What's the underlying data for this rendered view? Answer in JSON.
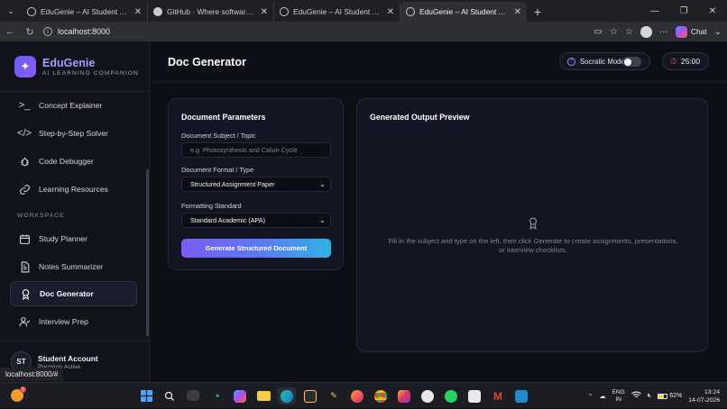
{
  "browser": {
    "tabs": [
      {
        "title": "EduGenie – AI Student Assistant",
        "active": false
      },
      {
        "title": "GitHub · Where software is built",
        "active": false
      },
      {
        "title": "EduGenie – AI Student Assistant",
        "active": false
      },
      {
        "title": "EduGenie – AI Student Assistant",
        "active": true
      }
    ],
    "url": "localhost:8000",
    "chat_label": "Chat",
    "status_url": "localhost:8000/#"
  },
  "brand": {
    "name": "EduGenie",
    "subtitle": "AI LEARNING COMPANION"
  },
  "sidebar": {
    "items": [
      {
        "label": "Concept Explainer",
        "icon": "terminal-icon"
      },
      {
        "label": "Step-by-Step Solver",
        "icon": "code-icon"
      },
      {
        "label": "Code Debugger",
        "icon": "bug-icon"
      },
      {
        "label": "Learning Resources",
        "icon": "link-icon"
      }
    ],
    "section_label": "WORKSPACE",
    "workspace_items": [
      {
        "label": "Study Planner",
        "icon": "calendar-icon"
      },
      {
        "label": "Notes Summarizer",
        "icon": "document-icon"
      },
      {
        "label": "Doc Generator",
        "icon": "award-icon",
        "active": true
      },
      {
        "label": "Interview Prep",
        "icon": "user-check-icon"
      }
    ],
    "account": {
      "initials": "ST",
      "name": "Student Account",
      "status": "Premium Active"
    }
  },
  "header": {
    "title": "Doc Generator",
    "socratic_label": "Socratic Mode",
    "socratic_on": false,
    "timer": "25:00"
  },
  "params": {
    "title": "Document Parameters",
    "subject_label": "Document Subject / Topic",
    "subject_placeholder": "e.g. Photosynthesis and Calvin Cycle",
    "subject_value": "",
    "format_label": "Document Format / Type",
    "format_value": "Structured Assignment Paper",
    "standard_label": "Formatting Standard",
    "standard_value": "Standard Academic (APA)",
    "generate_label": "Generate Structured Document"
  },
  "preview": {
    "title": "Generated Output Preview",
    "empty_text": "Fill in the subject and type on the left, then click Generate to create assignments, presentations, or interview checklists."
  },
  "taskbar": {
    "weather_badge": "1",
    "lang_top": "ENG",
    "lang_bottom": "IN",
    "battery": "62%",
    "time": "13:24",
    "date": "14-07-2026"
  },
  "colors": {
    "accent": "#8b5cf6",
    "brand_text": "#a99cff",
    "gradient_start": "#7a5cf6",
    "gradient_end": "#2eb3e6",
    "timer_icon": "#ff5577"
  }
}
